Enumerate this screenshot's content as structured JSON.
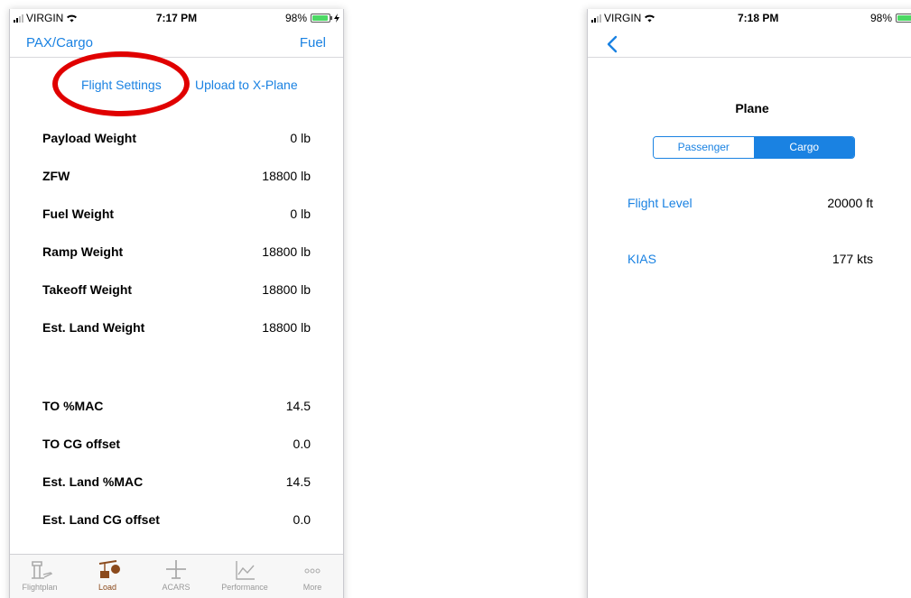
{
  "left_screen": {
    "status": {
      "carrier": "VIRGIN",
      "time": "7:17 PM",
      "battery": "98%",
      "battery_level": 0.98
    },
    "nav": {
      "left_label": "PAX/Cargo",
      "right_label": "Fuel"
    },
    "actions": {
      "flight_settings": "Flight Settings",
      "upload": "Upload to X-Plane"
    },
    "highlight_color": "#e00000",
    "rows": [
      {
        "label": "Payload Weight",
        "value": "0 lb"
      },
      {
        "label": "ZFW",
        "value": "18800 lb"
      },
      {
        "label": "Fuel Weight",
        "value": "0 lb"
      },
      {
        "label": "Ramp Weight",
        "value": "18800 lb"
      },
      {
        "label": "Takeoff Weight",
        "value": "18800 lb"
      },
      {
        "label": "Est. Land Weight",
        "value": "18800 lb"
      }
    ],
    "cg_rows": [
      {
        "label": "TO %MAC",
        "value": "14.5"
      },
      {
        "label": "TO CG offset",
        "value": "0.0"
      },
      {
        "label": "Est. Land %MAC",
        "value": "14.5"
      },
      {
        "label": "Est. Land CG offset",
        "value": "0.0"
      }
    ],
    "tabs": [
      {
        "label": "Flightplan",
        "icon": "control-tower-icon"
      },
      {
        "label": "Load",
        "icon": "cargo-load-icon",
        "active": true
      },
      {
        "label": "ACARS",
        "icon": "airplane-icon"
      },
      {
        "label": "Performance",
        "icon": "performance-chart-icon"
      },
      {
        "label": "More",
        "icon": "more-dots-icon"
      }
    ]
  },
  "right_screen": {
    "status": {
      "carrier": "VIRGIN",
      "time": "7:18 PM",
      "battery": "98%",
      "battery_level": 0.98
    },
    "title": "Plane",
    "segment": {
      "options": [
        "Passenger",
        "Cargo"
      ],
      "selected": "Cargo"
    },
    "rows": [
      {
        "label": "Flight Level",
        "value": "20000 ft"
      },
      {
        "label": "KIAS",
        "value": "177 kts"
      }
    ]
  },
  "colors": {
    "accent": "#1a82e2",
    "active_tab": "#8b4a1c",
    "highlight": "#e00000"
  }
}
